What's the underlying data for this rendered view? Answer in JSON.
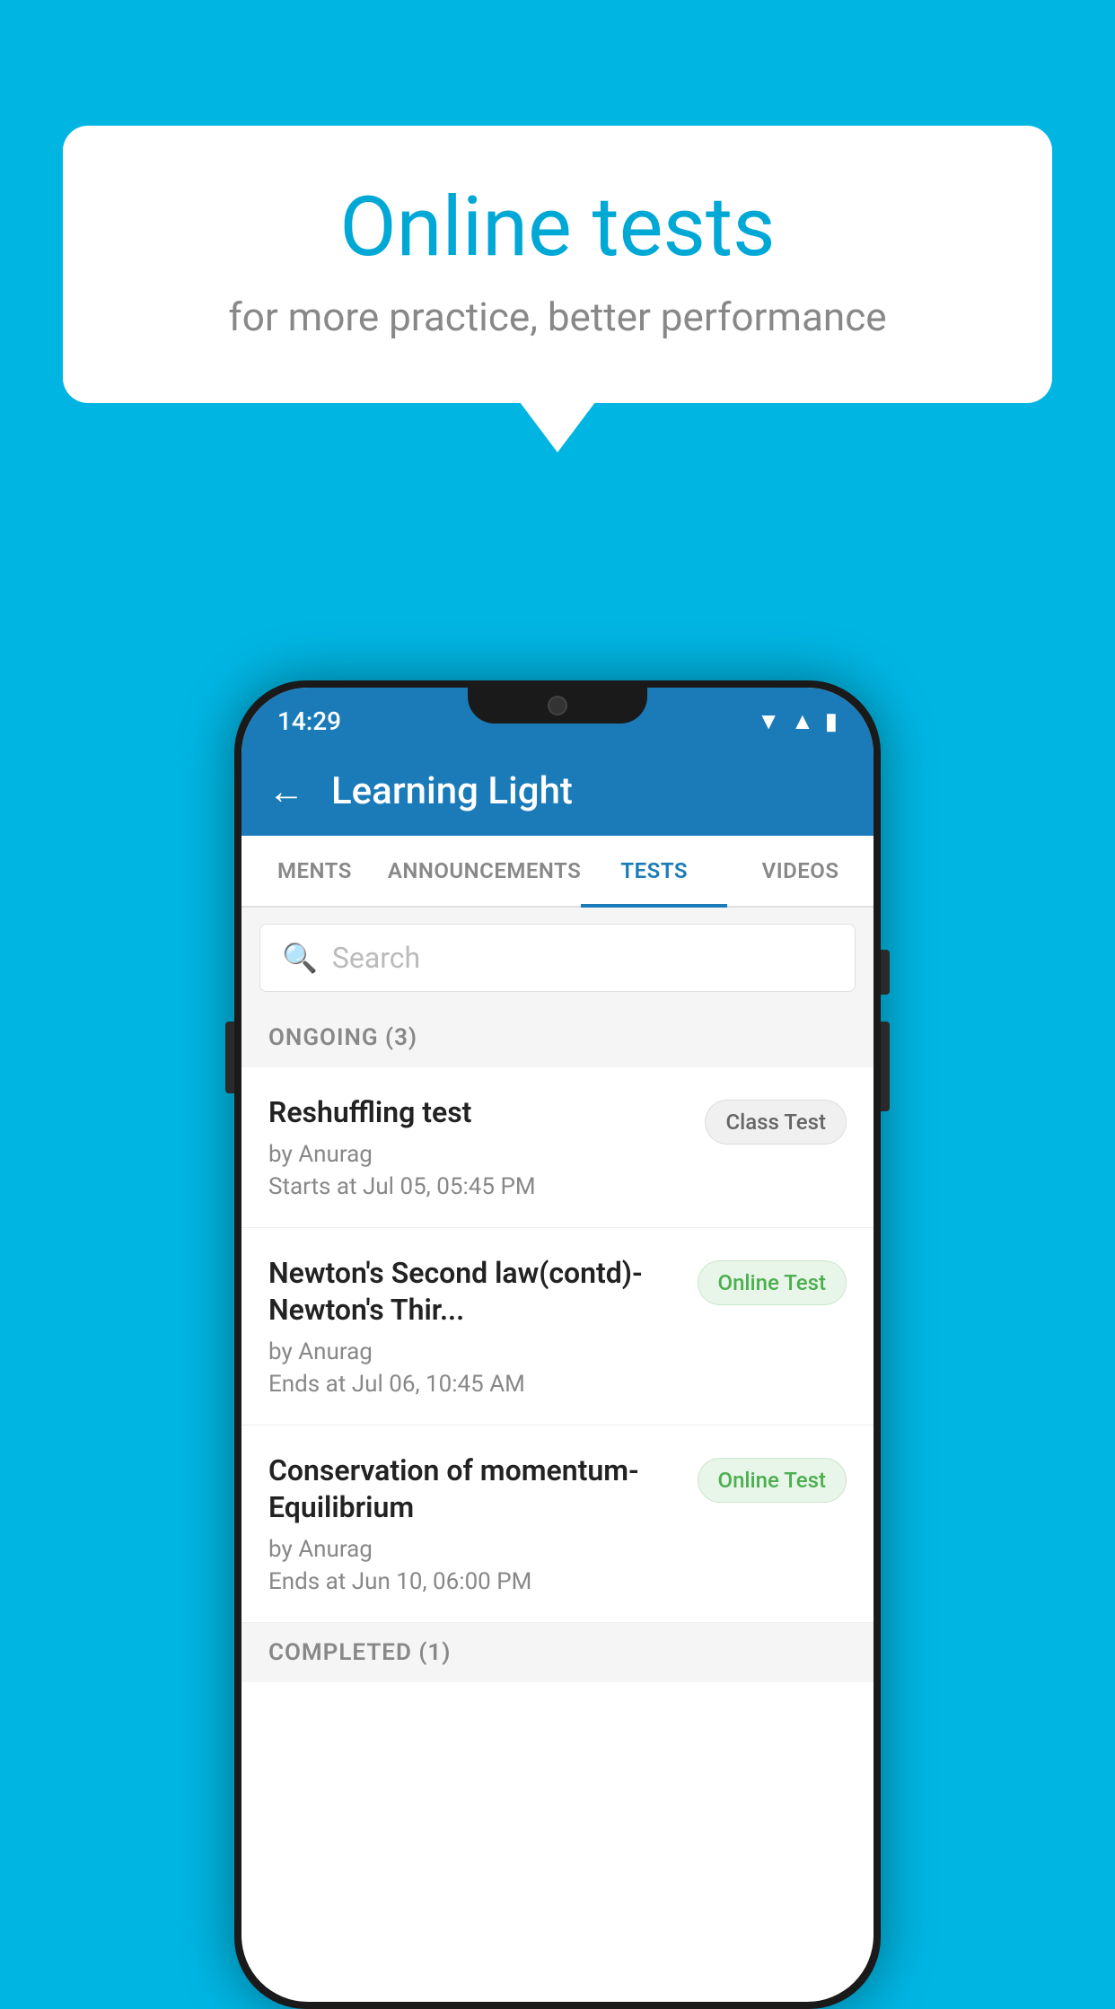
{
  "background": {
    "color": "#00b5e2"
  },
  "speech_bubble": {
    "title": "Online tests",
    "subtitle": "for more practice, better performance"
  },
  "phone": {
    "status_bar": {
      "time": "14:29",
      "icons": [
        "wifi",
        "signal",
        "battery"
      ]
    },
    "app_bar": {
      "title": "Learning Light",
      "back_label": "←"
    },
    "tabs": [
      {
        "label": "MENTS",
        "active": false
      },
      {
        "label": "ANNOUNCEMENTS",
        "active": false
      },
      {
        "label": "TESTS",
        "active": true
      },
      {
        "label": "VIDEOS",
        "active": false
      }
    ],
    "search": {
      "placeholder": "Search"
    },
    "ongoing_section": {
      "header": "ONGOING (3)",
      "tests": [
        {
          "title": "Reshuffling test",
          "author": "by Anurag",
          "date": "Starts at  Jul 05, 05:45 PM",
          "badge": "Class Test",
          "badge_type": "class"
        },
        {
          "title": "Newton's Second law(contd)-Newton's Thir...",
          "author": "by Anurag",
          "date": "Ends at  Jul 06, 10:45 AM",
          "badge": "Online Test",
          "badge_type": "online"
        },
        {
          "title": "Conservation of momentum-Equilibrium",
          "author": "by Anurag",
          "date": "Ends at  Jun 10, 06:00 PM",
          "badge": "Online Test",
          "badge_type": "online"
        }
      ]
    },
    "completed_section": {
      "header": "COMPLETED (1)"
    }
  }
}
